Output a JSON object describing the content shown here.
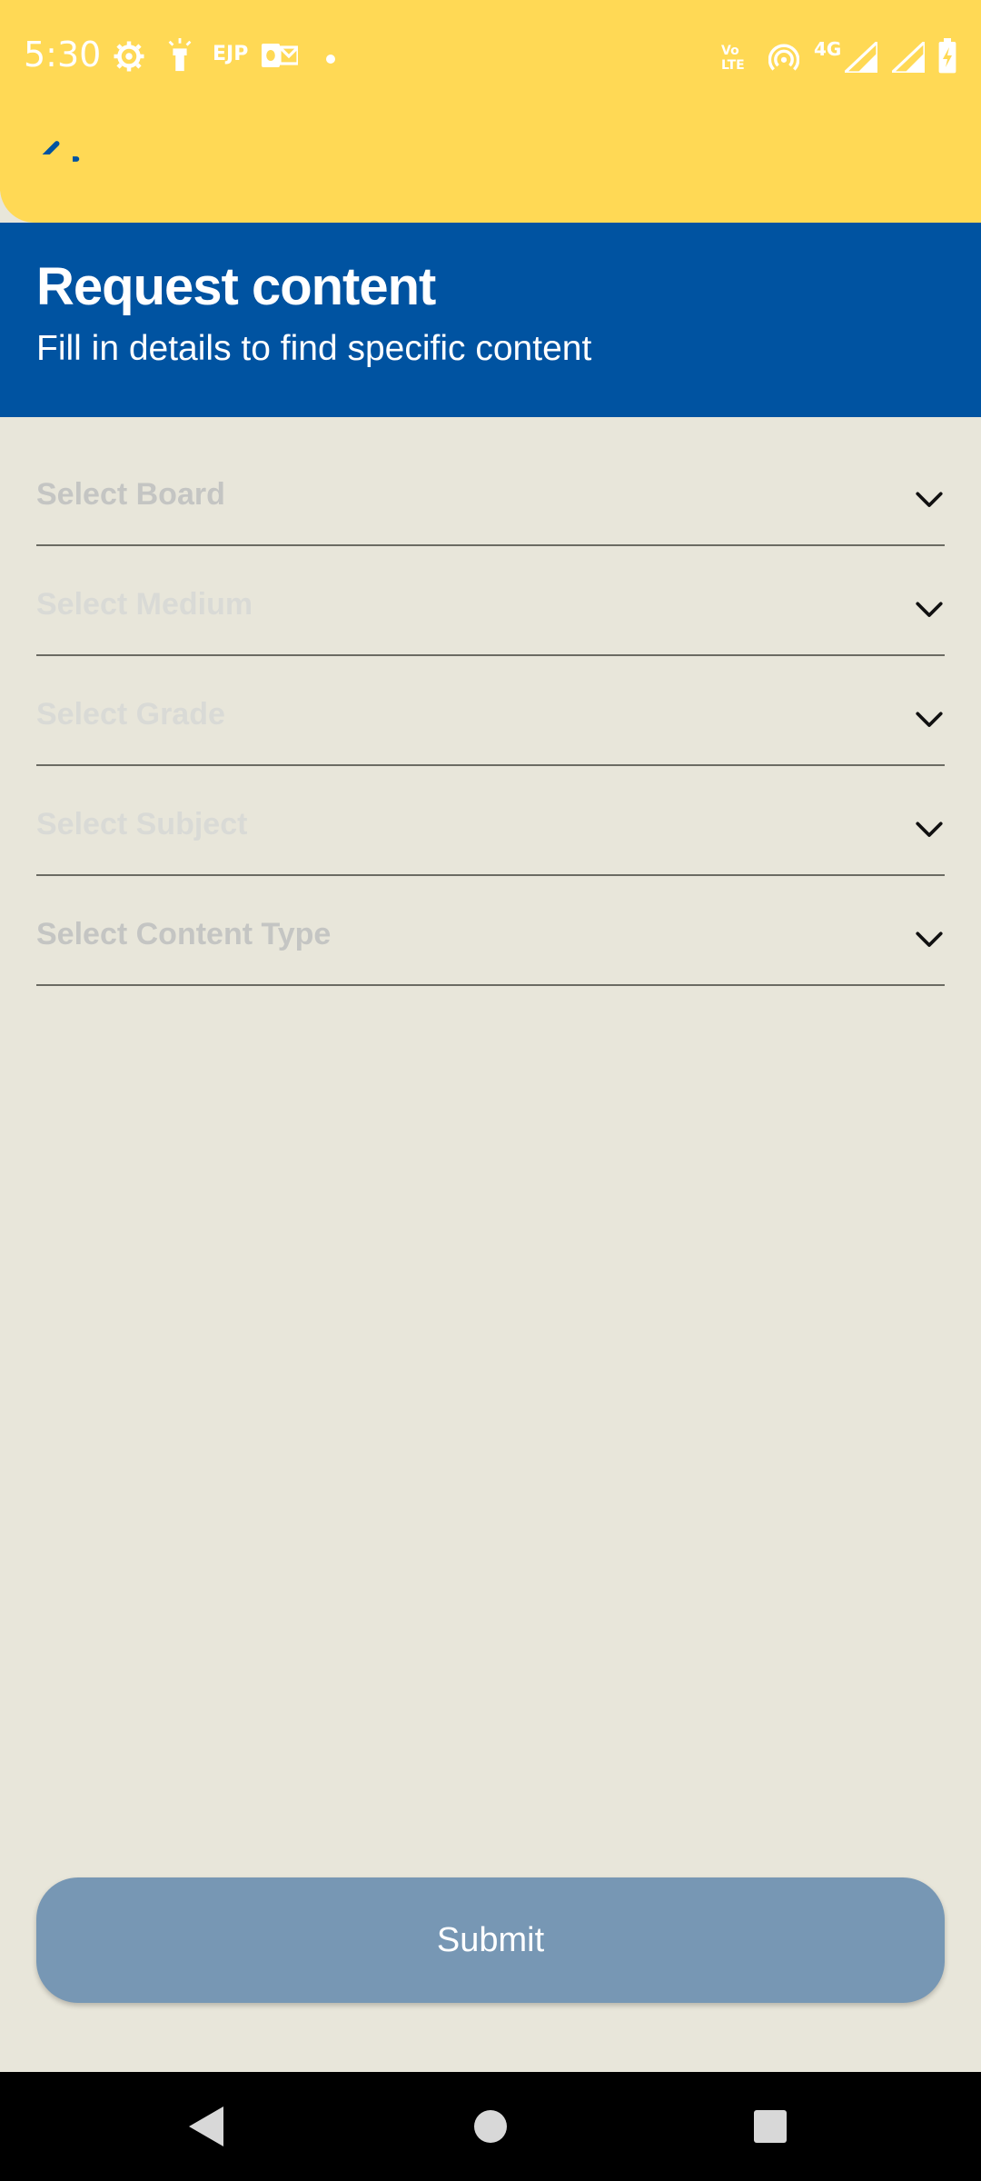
{
  "status_bar": {
    "time": "5:30",
    "left_icons": [
      "settings-gear-icon",
      "flashlight-icon",
      "ejp-text-icon",
      "outlook-icon",
      "dot-icon"
    ],
    "ejp_label": "EJP",
    "right_icons": [
      "volte-icon",
      "hotspot-icon",
      "4g-signal-icon",
      "signal-icon",
      "battery-charging-icon"
    ],
    "network_label": "4G",
    "volte_label": "Vo LTE"
  },
  "app_bar": {
    "back_icon": "arrow-left-icon",
    "background_color": "#ffd955",
    "icon_color": "#0053a1"
  },
  "header": {
    "title": "Request content",
    "subtitle": "Fill in details to find specific content",
    "background_color": "#0053a1"
  },
  "form": {
    "fields": [
      {
        "placeholder": "Select Board",
        "text_color": "#c4c5c3"
      },
      {
        "placeholder": "Select Medium",
        "text_color": "#d9dad6"
      },
      {
        "placeholder": "Select Grade",
        "text_color": "#d9dad6"
      },
      {
        "placeholder": "Select Subject",
        "text_color": "#d9dad6"
      },
      {
        "placeholder": "Select Content Type",
        "text_color": "#c4c5c3"
      }
    ],
    "chevron_icon": "chevron-down-icon"
  },
  "submit": {
    "label": "Submit",
    "background_color": "#7797b4"
  },
  "nav_bar": {
    "back_icon": "nav-back-triangle-icon",
    "home_icon": "nav-home-circle-icon",
    "recents_icon": "nav-recents-square-icon"
  }
}
